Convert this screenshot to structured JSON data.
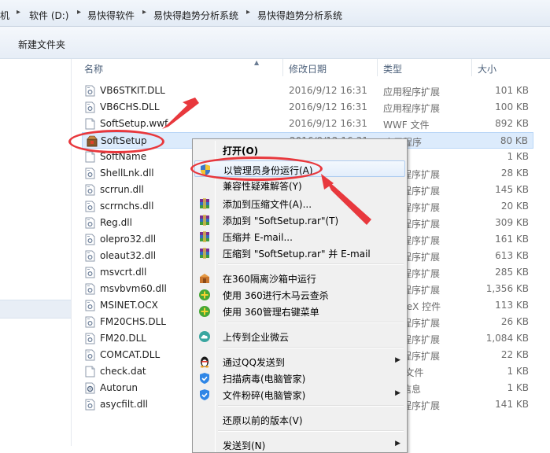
{
  "breadcrumb": [
    "机",
    "软件 (D:)",
    "易快得软件",
    "易快得趋势分析系统",
    "易快得趋势分析系统"
  ],
  "toolbar": {
    "new_folder": "新建文件夹"
  },
  "columns": {
    "name": "名称",
    "date": "修改日期",
    "type": "类型",
    "size": "大小"
  },
  "files": [
    {
      "icon": "dll-file-icon",
      "name": "VB6STKIT.DLL",
      "date": "2016/9/12 16:31",
      "type": "应用程序扩展",
      "size": "101 KB"
    },
    {
      "icon": "dll-file-icon",
      "name": "VB6CHS.DLL",
      "date": "2016/9/12 16:31",
      "type": "应用程序扩展",
      "size": "100 KB"
    },
    {
      "icon": "generic-file-icon",
      "name": "SoftSetup.wwf",
      "date": "2016/9/12 16:31",
      "type": "WWF 文件",
      "size": "892 KB"
    },
    {
      "icon": "setup-exe-icon",
      "name": "SoftSetup",
      "date": "2016/9/12 16:31",
      "type": "应用程序",
      "size": "80 KB"
    },
    {
      "icon": "generic-file-icon",
      "name": "SoftName",
      "date": "",
      "type": "文档",
      "size": "1 KB"
    },
    {
      "icon": "dll-file-icon",
      "name": "ShellLnk.dll",
      "date": "",
      "type": "应用程序扩展",
      "size": "28 KB"
    },
    {
      "icon": "dll-file-icon",
      "name": "scrrun.dll",
      "date": "",
      "type": "应用程序扩展",
      "size": "145 KB"
    },
    {
      "icon": "dll-file-icon",
      "name": "scrrnchs.dll",
      "date": "",
      "type": "应用程序扩展",
      "size": "20 KB"
    },
    {
      "icon": "dll-file-icon",
      "name": "Reg.dll",
      "date": "",
      "type": "应用程序扩展",
      "size": "309 KB"
    },
    {
      "icon": "dll-file-icon",
      "name": "olepro32.dll",
      "date": "",
      "type": "应用程序扩展",
      "size": "161 KB"
    },
    {
      "icon": "dll-file-icon",
      "name": "oleaut32.dll",
      "date": "",
      "type": "应用程序扩展",
      "size": "613 KB"
    },
    {
      "icon": "dll-file-icon",
      "name": "msvcrt.dll",
      "date": "",
      "type": "应用程序扩展",
      "size": "285 KB"
    },
    {
      "icon": "dll-file-icon",
      "name": "msvbvm60.dll",
      "date": "",
      "type": "应用程序扩展",
      "size": "1,356 KB"
    },
    {
      "icon": "ocx-file-icon",
      "name": "MSINET.OCX",
      "date": "",
      "type": "ActiveX 控件",
      "size": "113 KB"
    },
    {
      "icon": "dll-file-icon",
      "name": "FM20CHS.DLL",
      "date": "",
      "type": "应用程序扩展",
      "size": "26 KB"
    },
    {
      "icon": "dll-file-icon",
      "name": "FM20.DLL",
      "date": "",
      "type": "应用程序扩展",
      "size": "1,084 KB"
    },
    {
      "icon": "dll-file-icon",
      "name": "COMCAT.DLL",
      "date": "",
      "type": "应用程序扩展",
      "size": "22 KB"
    },
    {
      "icon": "generic-file-icon",
      "name": "check.dat",
      "date": "",
      "type": "DAT 文件",
      "size": "1 KB"
    },
    {
      "icon": "autorun-file-icon",
      "name": "Autorun",
      "date": "",
      "type": "安装信息",
      "size": "1 KB"
    },
    {
      "icon": "dll-file-icon",
      "name": "asycfilt.dll",
      "date": "",
      "type": "应用程序扩展",
      "size": "141 KB"
    }
  ],
  "context_menu": [
    {
      "icon": "",
      "label": "打开(O)",
      "bold": true
    },
    {
      "icon": "uac-shield-icon",
      "label": "以管理员身份运行(A)",
      "hover": true
    },
    {
      "icon": "",
      "label": "兼容性疑难解答(Y)"
    },
    {
      "icon": "winrar-books-icon",
      "label": "添加到压缩文件(A)..."
    },
    {
      "icon": "winrar-books-icon",
      "label": "添加到 \"SoftSetup.rar\"(T)"
    },
    {
      "icon": "winrar-books-icon",
      "label": "压缩并 E-mail..."
    },
    {
      "icon": "winrar-books-icon",
      "label": "压缩到 \"SoftSetup.rar\" 并 E-mail"
    },
    {
      "icon": "sandbox-icon",
      "label": "在360隔离沙箱中运行"
    },
    {
      "icon": "360-plus-icon",
      "label": "使用 360进行木马云查杀"
    },
    {
      "icon": "360-plus-icon",
      "label": "使用 360管理右键菜单"
    },
    {
      "icon": "cloud-upload-icon",
      "label": "上传到企业微云"
    },
    {
      "icon": "qq-penguin-icon",
      "label": "通过QQ发送到",
      "submenu": true
    },
    {
      "icon": "guard-shield-icon",
      "label": "扫描病毒(电脑管家)"
    },
    {
      "icon": "guard-shield-icon",
      "label": "文件粉碎(电脑管家)",
      "submenu": true
    },
    {
      "icon": "",
      "label": "还原以前的版本(V)"
    },
    {
      "icon": "",
      "label": "发送到(N)",
      "submenu": true
    }
  ],
  "colors": {
    "annotation_red": "#e8383d",
    "selection": "#dcebfc",
    "menu_bg": "#f0f0f0"
  }
}
